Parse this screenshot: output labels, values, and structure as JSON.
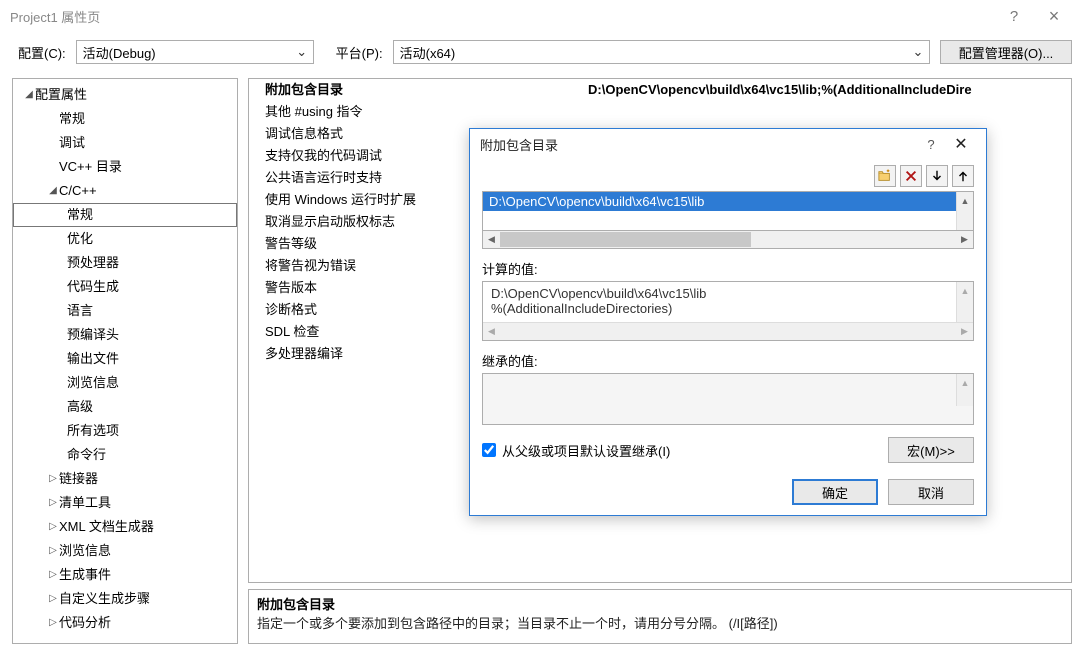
{
  "window": {
    "title": "Project1 属性页"
  },
  "toolbar": {
    "config_label": "配置(C):",
    "config_value": "活动(Debug)",
    "platform_label": "平台(P):",
    "platform_value": "活动(x64)",
    "manager_button": "配置管理器(O)..."
  },
  "tree": {
    "items": [
      {
        "label": "配置属性",
        "level": 1,
        "expander": "◢"
      },
      {
        "label": "常规",
        "level": 2
      },
      {
        "label": "调试",
        "level": 2
      },
      {
        "label": "VC++ 目录",
        "level": 2
      },
      {
        "label": "C/C++",
        "level": 2,
        "expander": "◢"
      },
      {
        "label": "常规",
        "level": 3,
        "selected": true
      },
      {
        "label": "优化",
        "level": 3
      },
      {
        "label": "预处理器",
        "level": 3
      },
      {
        "label": "代码生成",
        "level": 3
      },
      {
        "label": "语言",
        "level": 3
      },
      {
        "label": "预编译头",
        "level": 3
      },
      {
        "label": "输出文件",
        "level": 3
      },
      {
        "label": "浏览信息",
        "level": 3
      },
      {
        "label": "高级",
        "level": 3
      },
      {
        "label": "所有选项",
        "level": 3
      },
      {
        "label": "命令行",
        "level": 3
      },
      {
        "label": "链接器",
        "level": 2,
        "expander": "▷"
      },
      {
        "label": "清单工具",
        "level": 2,
        "expander": "▷"
      },
      {
        "label": "XML 文档生成器",
        "level": 2,
        "expander": "▷"
      },
      {
        "label": "浏览信息",
        "level": 2,
        "expander": "▷"
      },
      {
        "label": "生成事件",
        "level": 2,
        "expander": "▷"
      },
      {
        "label": "自定义生成步骤",
        "level": 2,
        "expander": "▷"
      },
      {
        "label": "代码分析",
        "level": 2,
        "expander": "▷"
      }
    ]
  },
  "props": {
    "rows": [
      {
        "label": "附加包含目录",
        "value": "D:\\OpenCV\\opencv\\build\\x64\\vc15\\lib;%(AdditionalIncludeDire",
        "highlight": true
      },
      {
        "label": "其他 #using 指令",
        "value": ""
      },
      {
        "label": "调试信息格式",
        "value": ""
      },
      {
        "label": "支持仅我的代码调试",
        "value": ""
      },
      {
        "label": "公共语言运行时支持",
        "value": ""
      },
      {
        "label": "使用 Windows 运行时扩展",
        "value": ""
      },
      {
        "label": "取消显示启动版权标志",
        "value": ""
      },
      {
        "label": "警告等级",
        "value": ""
      },
      {
        "label": "将警告视为错误",
        "value": ""
      },
      {
        "label": "警告版本",
        "value": ""
      },
      {
        "label": "诊断格式",
        "value": ""
      },
      {
        "label": "SDL 检查",
        "value": ""
      },
      {
        "label": "多处理器编译",
        "value": ""
      }
    ]
  },
  "desc": {
    "title": "附加包含目录",
    "text": "指定一个或多个要添加到包含路径中的目录；当目录不止一个时，请用分号分隔。    (/I[路径])"
  },
  "modal": {
    "title": "附加包含目录",
    "list_selected": "D:\\OpenCV\\opencv\\build\\x64\\vc15\\lib",
    "computed_label": "计算的值:",
    "computed_line1": "D:\\OpenCV\\opencv\\build\\x64\\vc15\\lib",
    "computed_line2": "%(AdditionalIncludeDirectories)",
    "inherited_label": "继承的值:",
    "inherit_checkbox": "从父级或项目默认设置继承(I)",
    "macro_button": "宏(M)>>",
    "ok_button": "确定",
    "cancel_button": "取消"
  }
}
